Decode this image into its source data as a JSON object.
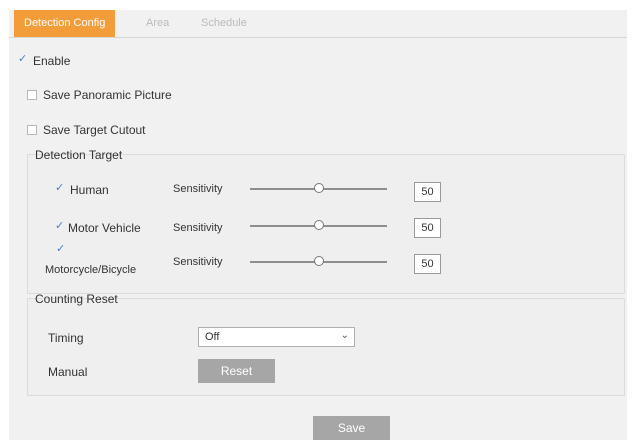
{
  "tabs": [
    {
      "label": "Detection Config",
      "active": true
    },
    {
      "label": "Area",
      "active": false
    },
    {
      "label": "Schedule",
      "active": false
    }
  ],
  "options": {
    "enable": {
      "label": "Enable",
      "checked": true
    },
    "save_panoramic": {
      "label": "Save Panoramic Picture",
      "checked": false
    },
    "save_target": {
      "label": "Save Target Cutout",
      "checked": false
    }
  },
  "detection_target": {
    "title": "Detection Target",
    "sensitivity_label": "Sensitivity",
    "rows": [
      {
        "label": "Human",
        "checked": true,
        "value": "50"
      },
      {
        "label": "Motor Vehicle",
        "checked": true,
        "value": "50"
      },
      {
        "label": "Motorcycle/Bicycle",
        "checked": true,
        "value": "50"
      }
    ]
  },
  "counting_reset": {
    "title": "Counting Reset",
    "timing_label": "Timing",
    "timing_value": "Off",
    "manual_label": "Manual",
    "reset_label": "Reset"
  },
  "save_label": "Save",
  "colors": {
    "accent": "#f39c3a",
    "button": "#a6a6a6",
    "check": "#4a7fc4"
  }
}
